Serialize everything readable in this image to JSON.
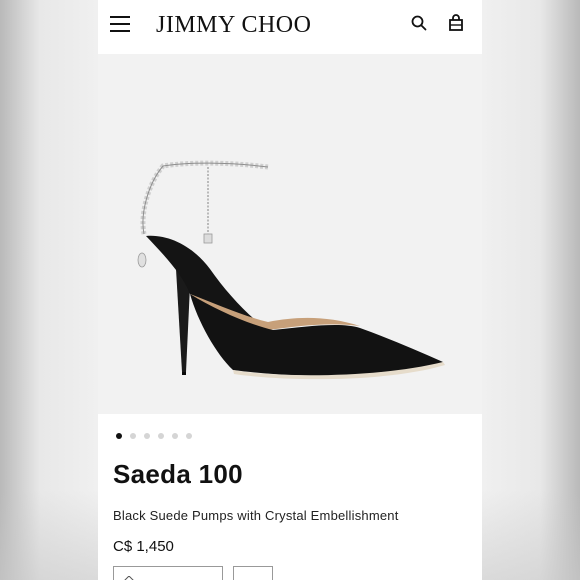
{
  "header": {
    "brand": "JIMMY CHOO",
    "menu_icon": "hamburger-menu-icon",
    "search_icon": "search-icon",
    "bag_icon": "shopping-bag-icon"
  },
  "gallery": {
    "image_subject": "black suede pointed pump with crystal ankle strap",
    "slide_count": 6,
    "active_slide": 1
  },
  "product": {
    "name": "Saeda 100",
    "description": "Black Suede Pumps with Crystal Embellishment",
    "price": "C$ 1,450"
  },
  "colors": {
    "text": "#111111",
    "background": "#ffffff",
    "hero_bg": "#f2f2f2"
  }
}
